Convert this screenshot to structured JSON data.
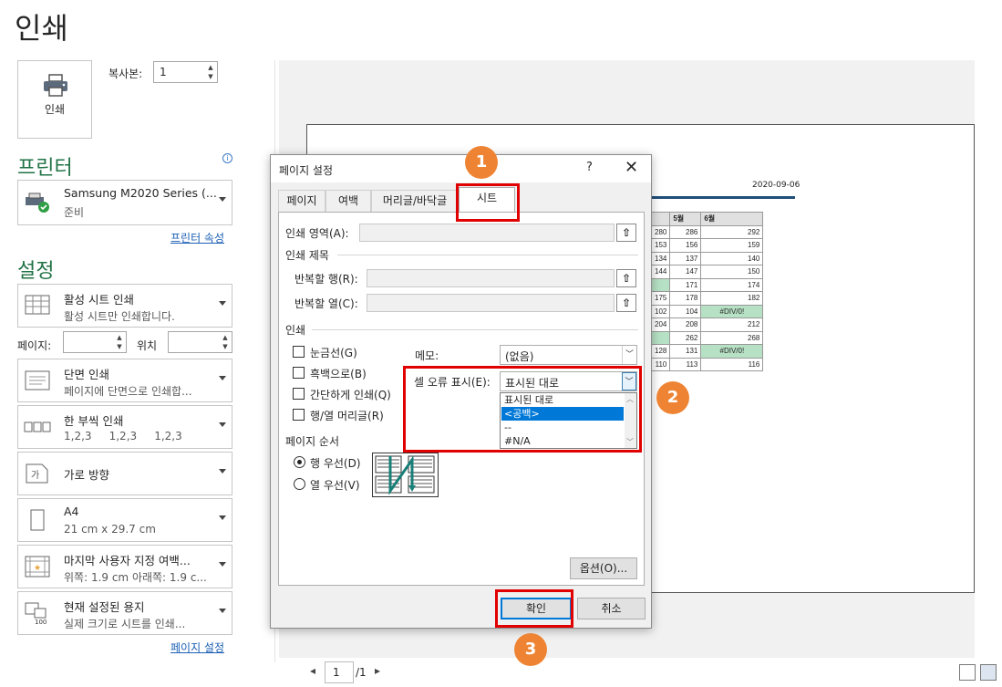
{
  "backstage": {
    "title": "인쇄",
    "print_button_label": "인쇄",
    "copies_label": "복사본:",
    "copies_value": "1"
  },
  "printer": {
    "heading": "프린터",
    "name": "Samsung M2020 Series (...",
    "status": "준비",
    "properties_link": "프린터 속성"
  },
  "settings": {
    "heading": "설정",
    "items": [
      {
        "l1": "활성 시트 인쇄",
        "l2": "활성 시트만 인쇄합니다."
      },
      {
        "l1": "단면 인쇄",
        "l2": "페이지에 단면으로 인쇄합..."
      },
      {
        "l1": "한 부씩 인쇄",
        "l2": "1,2,3     1,2,3     1,2,3"
      },
      {
        "l1": "가로 방향",
        "l2": ""
      },
      {
        "l1": "A4",
        "l2": "21 cm x 29.7 cm"
      },
      {
        "l1": "마지막 사용자 지정 여백...",
        "l2": "위쪽: 1.9 cm 아래쪽: 1.9 c..."
      },
      {
        "l1": "현재 설정된 용지",
        "l2": "실제 크기로 시트를 인쇄..."
      }
    ],
    "pages_label": "페이지:",
    "to_label": "위치",
    "page_setup_link": "페이지 설정"
  },
  "preview": {
    "date": "2020-09-06",
    "headers": [
      "",
      "5월",
      "6월"
    ],
    "rows": [
      [
        "280",
        "286",
        "292"
      ],
      [
        "153",
        "156",
        "159"
      ],
      [
        "134",
        "137",
        "140"
      ],
      [
        "144",
        "147",
        "150"
      ],
      [
        "",
        "171",
        "174"
      ],
      [
        "175",
        "178",
        "182"
      ],
      [
        "102",
        "104",
        "#DIV/0!"
      ],
      [
        "204",
        "208",
        "212"
      ],
      [
        "",
        "262",
        "268"
      ],
      [
        "128",
        "131",
        "#DIV/0!"
      ],
      [
        "110",
        "113",
        "116"
      ]
    ],
    "page_current": "1",
    "page_total": "/1"
  },
  "dialog": {
    "title": "페이지 설정",
    "help": "?",
    "close": "✕",
    "tabs": [
      "페이지",
      "여백",
      "머리글/바닥글",
      "시트"
    ],
    "print_area_label": "인쇄 영역(A):",
    "print_titles_label": "인쇄 제목",
    "rows_repeat_label": "반복할 행(R):",
    "cols_repeat_label": "반복할 열(C):",
    "print_group_label": "인쇄",
    "gridlines": "눈금선(G)",
    "black_white": "흑백으로(B)",
    "draft": "간단하게 인쇄(Q)",
    "row_col_headings": "행/열 머리글(R)",
    "comments_label": "메모:",
    "comments_value": "(없음)",
    "cell_errors_label": "셀 오류 표시(E):",
    "cell_errors_value": "표시된 대로",
    "cell_errors_options": [
      "표시된 대로",
      "<공백>",
      "--",
      "#N/A"
    ],
    "page_order_label": "페이지 순서",
    "down_then_over": "행 우선(D)",
    "over_then_down": "열 우선(V)",
    "options_button": "옵션(O)...",
    "ok_button": "확인",
    "cancel_button": "취소"
  },
  "callouts": [
    "1",
    "2",
    "3"
  ],
  "colors": {
    "accent": "#217346",
    "callout": "#ee8433",
    "highlight": "#e00000",
    "selection": "#0078d7"
  }
}
